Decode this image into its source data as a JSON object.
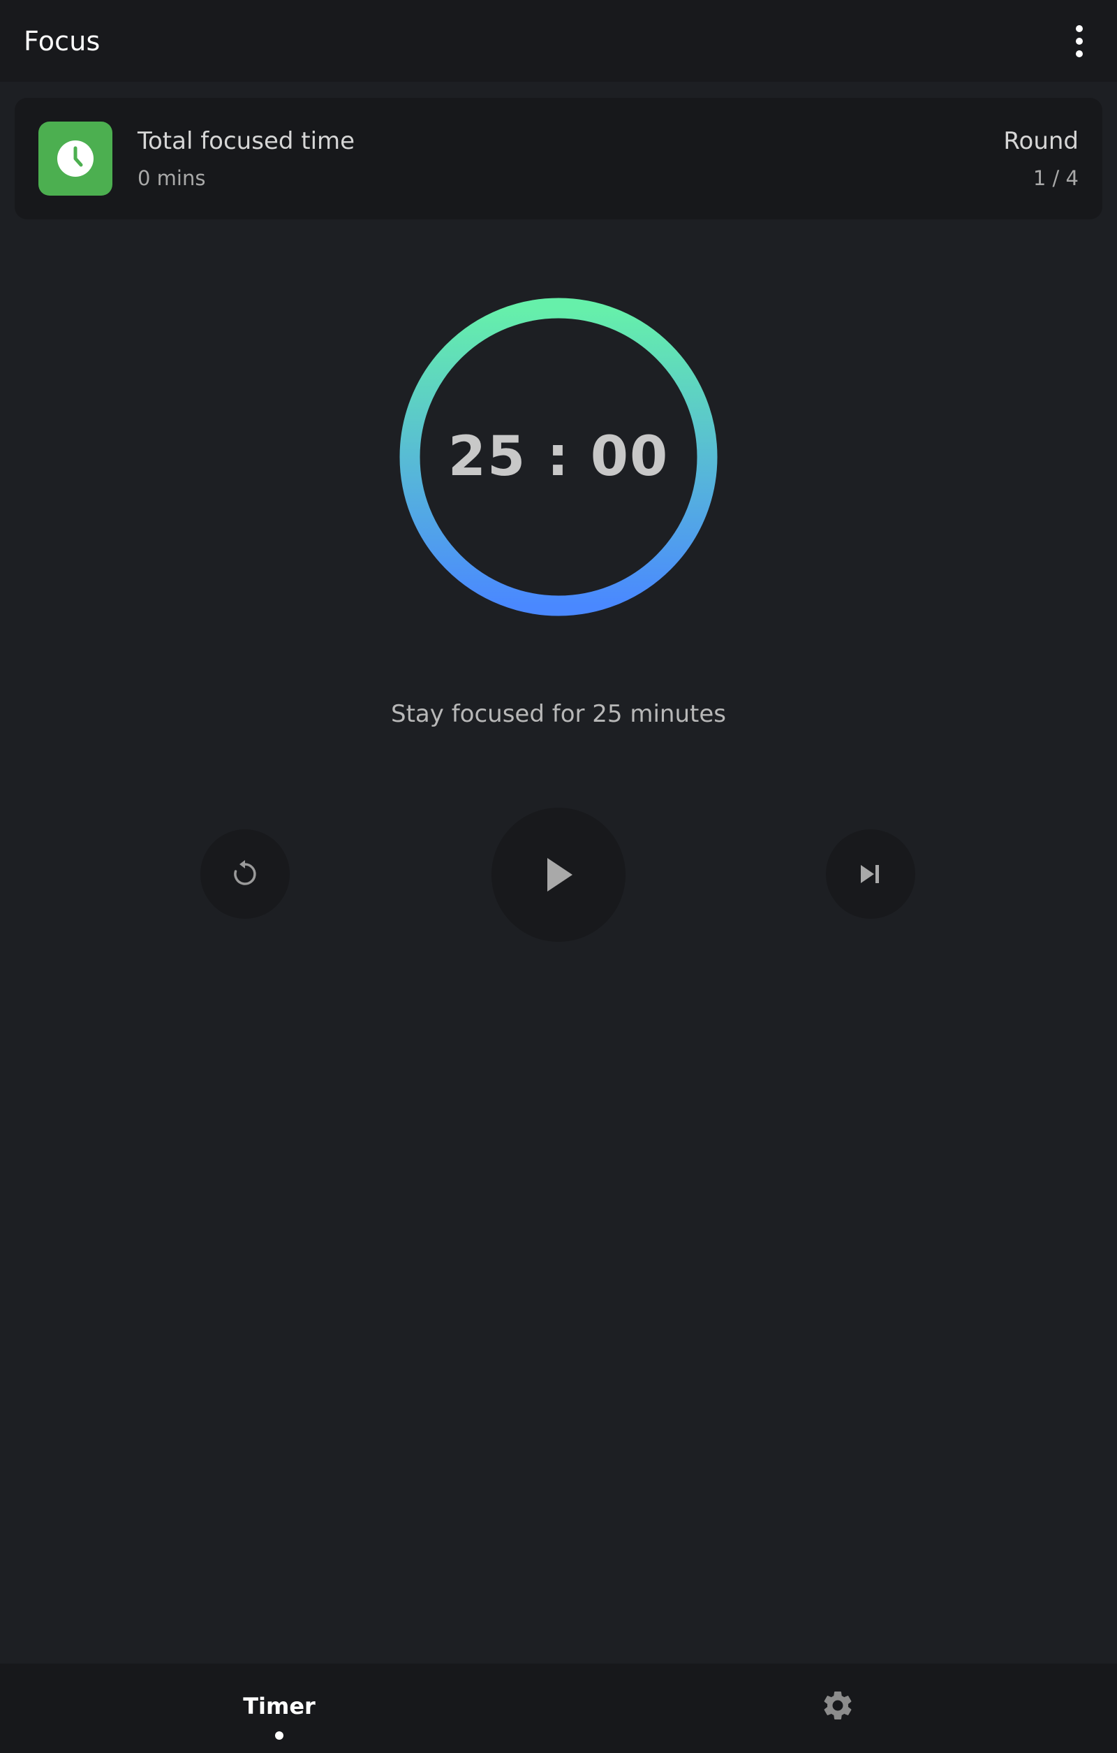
{
  "appbar": {
    "title": "Focus",
    "menu_icon": "more-vert-icon"
  },
  "stats": {
    "icon": "clock-icon",
    "icon_color": "#4caf50",
    "total_label": "Total focused time",
    "total_value": "0 mins",
    "round_label": "Round",
    "round_value": "1 / 4"
  },
  "timer": {
    "display": "25 : 00",
    "progress": 1.0,
    "gradient_colors": [
      "#4a88ff",
      "#66f0aa"
    ]
  },
  "subtitle": "Stay focused for 25 minutes",
  "controls": {
    "reset_icon": "reset-icon",
    "play_icon": "play-icon",
    "skip_icon": "skip-next-icon"
  },
  "bottom_nav": {
    "timer_label": "Timer",
    "settings_icon": "gear-icon"
  },
  "colors": {
    "background": "#1d1f23",
    "surface": "#17181b"
  }
}
